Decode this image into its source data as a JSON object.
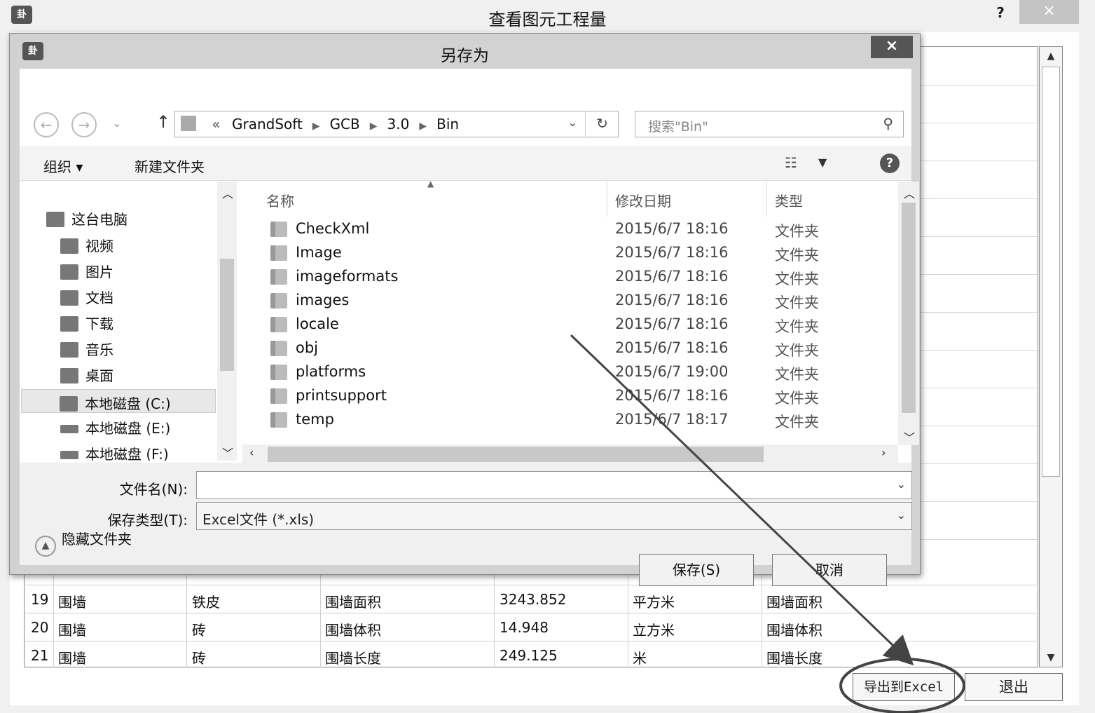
{
  "outer_window": {
    "title": "查看图元工程量",
    "icon_glyph": "卦",
    "help_label": "?",
    "close_label": "×",
    "rows": [
      {
        "num": "19",
        "name": "围墙",
        "material": "铁皮",
        "item": "围墙面积",
        "value": "3243.852",
        "unit": "平方米",
        "desc": "围墙面积"
      },
      {
        "num": "20",
        "name": "围墙",
        "material": "砖",
        "item": "围墙体积",
        "value": "14.948",
        "unit": "立方米",
        "desc": "围墙体积"
      },
      {
        "num": "21",
        "name": "围墙",
        "material": "砖",
        "item": "围墙长度",
        "value": "249.125",
        "unit": "米",
        "desc": "围墙长度"
      }
    ],
    "export_button": "导出到Excel",
    "exit_button": "退出"
  },
  "dialog": {
    "title": "另存为",
    "close_label": "×",
    "breadcrumb": [
      "GrandSoft",
      "GCB",
      "3.0",
      "Bin"
    ],
    "breadcrumb_prefix": "«",
    "search_placeholder": "搜索\"Bin\"",
    "toolbar": {
      "organize": "组织 ▾",
      "new_folder": "新建文件夹"
    },
    "nav_items": [
      {
        "label": "这台电脑",
        "icon": "computer-icon"
      },
      {
        "label": "视频",
        "icon": "video-folder-icon"
      },
      {
        "label": "图片",
        "icon": "pictures-folder-icon"
      },
      {
        "label": "文档",
        "icon": "documents-folder-icon"
      },
      {
        "label": "下载",
        "icon": "downloads-folder-icon"
      },
      {
        "label": "音乐",
        "icon": "music-folder-icon"
      },
      {
        "label": "桌面",
        "icon": "desktop-folder-icon"
      },
      {
        "label": "本地磁盘 (C:)",
        "icon": "drive-c-icon"
      },
      {
        "label": "本地磁盘 (E:)",
        "icon": "drive-icon"
      },
      {
        "label": "本地磁盘 (F:)",
        "icon": "drive-icon"
      }
    ],
    "columns": {
      "name": "名称",
      "date": "修改日期",
      "type": "类型"
    },
    "files": [
      {
        "name": "CheckXml",
        "date": "2015/6/7 18:16",
        "type": "文件夹"
      },
      {
        "name": "Image",
        "date": "2015/6/7 18:16",
        "type": "文件夹"
      },
      {
        "name": "imageformats",
        "date": "2015/6/7 18:16",
        "type": "文件夹"
      },
      {
        "name": "images",
        "date": "2015/6/7 18:16",
        "type": "文件夹"
      },
      {
        "name": "locale",
        "date": "2015/6/7 18:16",
        "type": "文件夹"
      },
      {
        "name": "obj",
        "date": "2015/6/7 18:16",
        "type": "文件夹"
      },
      {
        "name": "platforms",
        "date": "2015/6/7 19:00",
        "type": "文件夹"
      },
      {
        "name": "printsupport",
        "date": "2015/6/7 18:16",
        "type": "文件夹"
      },
      {
        "name": "temp",
        "date": "2015/6/7 18:17",
        "type": "文件夹"
      }
    ],
    "filename_label": "文件名(N):",
    "filename_value": "",
    "filetype_label": "保存类型(T):",
    "filetype_value": "Excel文件 (*.xls)",
    "hide_folders": "隐藏文件夹",
    "save_button": "保存(S)",
    "cancel_button": "取消"
  }
}
